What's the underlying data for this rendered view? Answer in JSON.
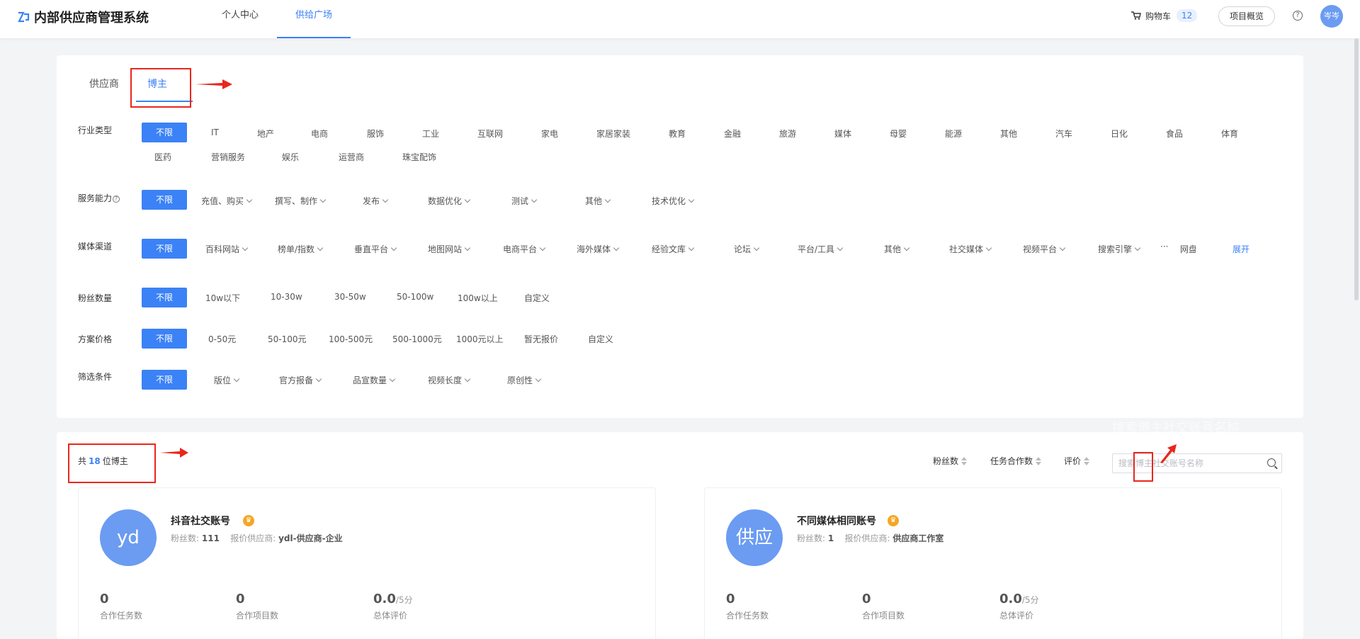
{
  "header": {
    "app_title": "内部供应商管理系统",
    "nav": [
      {
        "label": "个人中心"
      },
      {
        "label": "供给广场"
      }
    ],
    "cart_label": "购物车",
    "cart_count": "12",
    "overview_label": "项目概览",
    "help_symbol": "?",
    "user_avatar_text": "岑岑"
  },
  "tabs": [
    {
      "label": "供应商"
    },
    {
      "label": "博主"
    }
  ],
  "filters": {
    "all_label": "不限",
    "industry": {
      "label": "行业类型",
      "options_row1": [
        "IT",
        "地产",
        "电商",
        "服饰",
        "工业",
        "互联网",
        "家电",
        "家居家装",
        "教育",
        "金融",
        "旅游",
        "媒体",
        "母婴",
        "能源",
        "其他",
        "汽车",
        "日化",
        "食品",
        "体育"
      ],
      "options_row2": [
        "医药",
        "营销服务",
        "娱乐",
        "运营商",
        "珠宝配饰"
      ]
    },
    "service": {
      "label": "服务能力",
      "help_symbol": "?",
      "options": [
        "充值、购买",
        "撰写、制作",
        "发布",
        "数据优化",
        "测试",
        "其他",
        "技术优化"
      ]
    },
    "media": {
      "label": "媒体渠道",
      "options": [
        "百科网站",
        "榜单/指数",
        "垂直平台",
        "地图网站",
        "电商平台",
        "海外媒体",
        "经验文库",
        "论坛",
        "平台/工具",
        "其他",
        "社交媒体",
        "视频平台",
        "搜索引擎"
      ],
      "ellipsis": "···",
      "truncated": "网盘",
      "expand_label": "展开"
    },
    "fans": {
      "label": "粉丝数量",
      "options": [
        "10w以下",
        "10-30w",
        "30-50w",
        "50-100w",
        "100w以上",
        "自定义"
      ]
    },
    "price": {
      "label": "方案价格",
      "options": [
        "0-50元",
        "50-100元",
        "100-500元",
        "500-1000元",
        "1000元以上",
        "暂无报价",
        "自定义"
      ]
    },
    "screen": {
      "label": "筛选条件",
      "options": [
        "版位",
        "官方报备",
        "品宣数量",
        "视频长度",
        "原创性"
      ]
    }
  },
  "results": {
    "count_prefix": "共",
    "count": "18",
    "count_suffix": "位博主",
    "sort": [
      {
        "label": "粉丝数"
      },
      {
        "label": "任务合作数"
      },
      {
        "label": "评价"
      }
    ],
    "search_placeholder": "搜索博主社交账号名称",
    "ghost_text": "搜索博主社交账号名称",
    "cards": [
      {
        "avatar_text": "yd",
        "name": "抖音社交账号",
        "fans_label": "粉丝数:",
        "fans_value": "111",
        "supplier_label": "报价供应商:",
        "supplier_value": "ydl-供应商-企业",
        "stats": [
          {
            "value": "0",
            "unit": "",
            "label": "合作任务数"
          },
          {
            "value": "0",
            "unit": "",
            "label": "合作项目数"
          },
          {
            "value": "0.0",
            "unit": "/5分",
            "label": "总体评价"
          }
        ]
      },
      {
        "avatar_text": "供应",
        "name": "不同媒体相同账号",
        "fans_label": "粉丝数:",
        "fans_value": "1",
        "supplier_label": "报价供应商:",
        "supplier_value": "供应商工作室",
        "stats": [
          {
            "value": "0",
            "unit": "",
            "label": "合作任务数"
          },
          {
            "value": "0",
            "unit": "",
            "label": "合作项目数"
          },
          {
            "value": "0.0",
            "unit": "/5分",
            "label": "总体评价"
          }
        ]
      }
    ]
  },
  "colors": {
    "accent": "#3b82f6",
    "annotation_red": "#e8271d",
    "crown": "#f5a623"
  }
}
